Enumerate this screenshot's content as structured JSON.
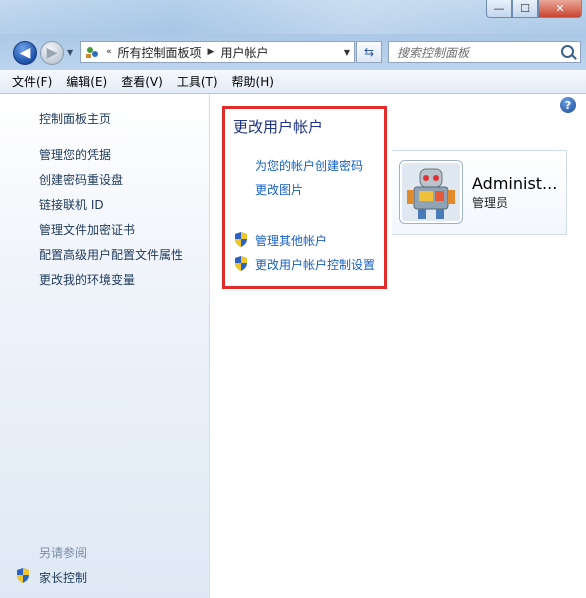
{
  "window": {
    "minimize_glyph": "—",
    "maximize_glyph": "☐",
    "close_glyph": "✕"
  },
  "navigation": {
    "back_icon": "back-arrow-icon",
    "forward_icon": "forward-arrow-icon",
    "overflow": "«",
    "breadcrumb": [
      "所有控制面板项",
      "用户帐户"
    ],
    "search_placeholder": "搜索控制面板"
  },
  "menubar": [
    "文件(F)",
    "编辑(E)",
    "查看(V)",
    "工具(T)",
    "帮助(H)"
  ],
  "sidebar": {
    "home": "控制面板主页",
    "links": [
      "管理您的凭据",
      "创建密码重设盘",
      "链接联机 ID",
      "管理文件加密证书",
      "配置高级用户配置文件属性",
      "更改我的环境变量"
    ],
    "see_also_title": "另请参阅",
    "see_also_links": [
      "家长控制"
    ]
  },
  "main": {
    "help_glyph": "?",
    "heading": "更改用户帐户",
    "tasks": [
      "为您的帐户创建密码",
      "更改图片"
    ],
    "admin_tasks": [
      "管理其他帐户",
      "更改用户帐户控制设置"
    ],
    "user": {
      "name": "Administ...",
      "role": "管理员"
    },
    "highlight_color": "#e22b2b"
  }
}
